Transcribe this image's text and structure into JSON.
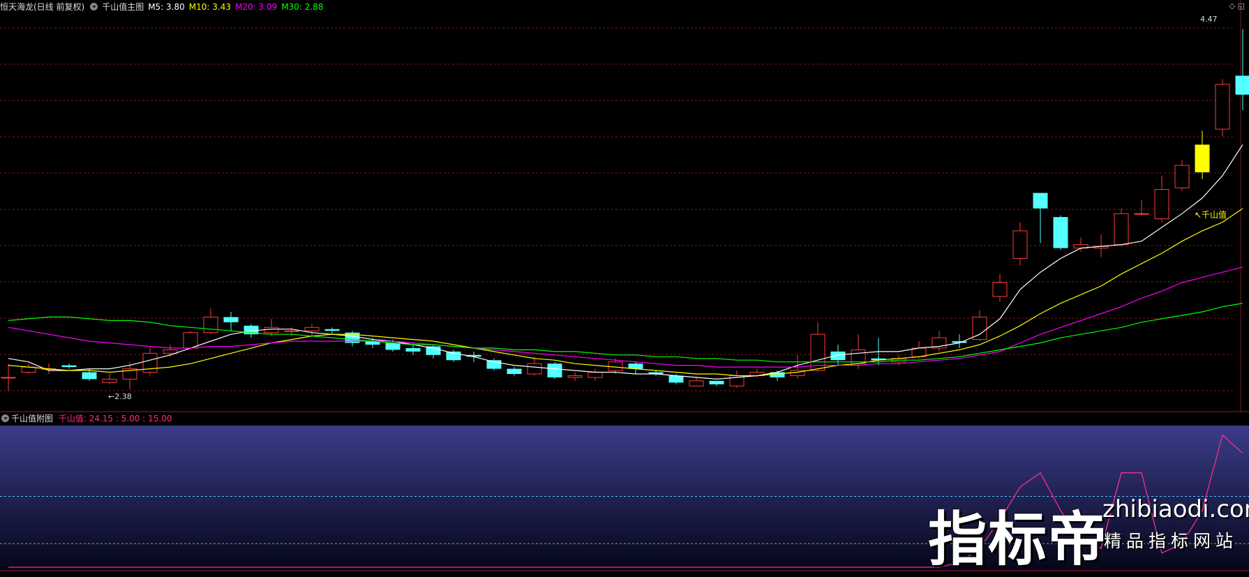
{
  "header": {
    "stock": "恒天海龙(日线 前复权)",
    "indicator": "千山值主图",
    "ma5": "M5: 3.80",
    "ma10": "M10: 3.43",
    "ma20": "M20: 3.09",
    "ma30": "M30: 2.88",
    "corner": "◇ ◱"
  },
  "sub_header": {
    "indicator": "千山值附图",
    "values": "千山值: 24.15 : 5.00 : 15.00"
  },
  "annotations": {
    "high": "4.47",
    "low": "←2.38",
    "qianshan": "↖千山值"
  },
  "watermark": {
    "big": "指标帝",
    "domain": "zhibiaodi.com",
    "slogan": "精品指标网站"
  },
  "colors": {
    "up": "#ff3c3c",
    "down": "#54ffff",
    "highlight": "#ffff00",
    "ma5": "#ffffff",
    "ma10": "#ffff00",
    "ma20": "#ff00ff",
    "ma30": "#00ff00",
    "sub_line": "#ff2a8a",
    "grid": "#801818"
  },
  "chart_data": {
    "type": "candlestick",
    "price_range": [
      2.3,
      4.55
    ],
    "candles": [
      [
        2.45,
        2.45,
        2.53,
        2.37
      ],
      [
        2.48,
        2.51,
        2.53,
        2.47
      ],
      [
        2.5,
        2.5,
        2.53,
        2.47
      ],
      [
        2.52,
        2.51,
        2.53,
        2.5
      ],
      [
        2.48,
        2.44,
        2.5,
        2.43
      ],
      [
        2.42,
        2.44,
        2.47,
        2.41
      ],
      [
        2.44,
        2.5,
        2.54,
        2.38
      ],
      [
        2.48,
        2.59,
        2.62,
        2.46
      ],
      [
        2.59,
        2.61,
        2.64,
        2.57
      ],
      [
        2.62,
        2.71,
        2.72,
        2.61
      ],
      [
        2.71,
        2.8,
        2.85,
        2.7
      ],
      [
        2.8,
        2.77,
        2.83,
        2.72
      ],
      [
        2.75,
        2.7,
        2.76,
        2.68
      ],
      [
        2.71,
        2.74,
        2.79,
        2.69
      ],
      [
        2.72,
        2.72,
        2.74,
        2.69
      ],
      [
        2.72,
        2.74,
        2.76,
        2.69
      ],
      [
        2.73,
        2.72,
        2.74,
        2.7
      ],
      [
        2.71,
        2.65,
        2.72,
        2.63
      ],
      [
        2.66,
        2.64,
        2.68,
        2.62
      ],
      [
        2.65,
        2.61,
        2.67,
        2.6
      ],
      [
        2.62,
        2.6,
        2.65,
        2.58
      ],
      [
        2.63,
        2.58,
        2.64,
        2.56
      ],
      [
        2.6,
        2.55,
        2.61,
        2.54
      ],
      [
        2.58,
        2.57,
        2.6,
        2.54
      ],
      [
        2.55,
        2.5,
        2.56,
        2.49
      ],
      [
        2.5,
        2.47,
        2.51,
        2.46
      ],
      [
        2.47,
        2.53,
        2.57,
        2.46
      ],
      [
        2.53,
        2.45,
        2.54,
        2.44
      ],
      [
        2.45,
        2.46,
        2.48,
        2.43
      ],
      [
        2.45,
        2.48,
        2.5,
        2.43
      ],
      [
        2.49,
        2.54,
        2.56,
        2.47
      ],
      [
        2.53,
        2.5,
        2.54,
        2.47
      ],
      [
        2.48,
        2.47,
        2.49,
        2.46
      ],
      [
        2.46,
        2.42,
        2.47,
        2.41
      ],
      [
        2.4,
        2.43,
        2.45,
        2.4
      ],
      [
        2.43,
        2.41,
        2.43,
        2.4
      ],
      [
        2.4,
        2.46,
        2.49,
        2.39
      ],
      [
        2.46,
        2.48,
        2.5,
        2.45
      ],
      [
        2.48,
        2.45,
        2.49,
        2.43
      ],
      [
        2.46,
        2.49,
        2.58,
        2.44
      ],
      [
        2.49,
        2.7,
        2.77,
        2.48
      ],
      [
        2.6,
        2.55,
        2.64,
        2.52
      ],
      [
        2.53,
        2.61,
        2.7,
        2.5
      ],
      [
        2.56,
        2.55,
        2.68,
        2.52
      ],
      [
        2.54,
        2.56,
        2.58,
        2.52
      ],
      [
        2.57,
        2.62,
        2.66,
        2.56
      ],
      [
        2.62,
        2.68,
        2.72,
        2.6
      ],
      [
        2.66,
        2.65,
        2.7,
        2.62
      ],
      [
        2.67,
        2.8,
        2.84,
        2.66
      ],
      [
        2.92,
        3.0,
        3.05,
        2.89
      ],
      [
        3.14,
        3.3,
        3.35,
        3.1
      ],
      [
        3.52,
        3.43,
        3.52,
        3.23
      ],
      [
        3.38,
        3.2,
        3.39,
        3.19
      ],
      [
        3.2,
        3.22,
        3.26,
        3.18
      ],
      [
        3.2,
        3.21,
        3.28,
        3.15
      ],
      [
        3.22,
        3.4,
        3.43,
        3.21
      ],
      [
        3.4,
        3.4,
        3.48,
        3.39
      ],
      [
        3.37,
        3.54,
        3.62,
        3.35
      ],
      [
        3.55,
        3.68,
        3.71,
        3.53
      ],
      [
        3.8,
        3.64,
        3.88,
        3.6
      ],
      [
        3.89,
        4.15,
        4.18,
        3.85
      ],
      [
        4.2,
        4.09,
        4.47,
        4.0
      ]
    ],
    "ma_series": [
      {
        "name": "M5",
        "color": "#ffffff",
        "y": [
          2.56,
          2.54,
          2.49,
          2.49,
          2.5,
          2.5,
          2.52,
          2.55,
          2.58,
          2.62,
          2.66,
          2.7,
          2.72,
          2.73,
          2.73,
          2.71,
          2.7,
          2.69,
          2.67,
          2.66,
          2.64,
          2.62,
          2.59,
          2.57,
          2.54,
          2.52,
          2.51,
          2.5,
          2.49,
          2.48,
          2.48,
          2.47,
          2.47,
          2.46,
          2.45,
          2.44,
          2.45,
          2.46,
          2.48,
          2.52,
          2.55,
          2.58,
          2.59,
          2.6,
          2.6,
          2.62,
          2.63,
          2.65,
          2.7,
          2.79,
          2.96,
          3.06,
          3.14,
          3.2,
          3.21,
          3.22,
          3.24,
          3.32,
          3.4,
          3.49,
          3.62,
          3.8
        ]
      },
      {
        "name": "M10",
        "color": "#ffff00",
        "y": [
          2.52,
          2.51,
          2.5,
          2.49,
          2.49,
          2.48,
          2.49,
          2.5,
          2.51,
          2.53,
          2.56,
          2.59,
          2.62,
          2.65,
          2.67,
          2.69,
          2.7,
          2.7,
          2.69,
          2.68,
          2.67,
          2.66,
          2.64,
          2.62,
          2.6,
          2.58,
          2.56,
          2.55,
          2.53,
          2.52,
          2.51,
          2.5,
          2.49,
          2.48,
          2.47,
          2.47,
          2.46,
          2.46,
          2.47,
          2.48,
          2.5,
          2.52,
          2.53,
          2.55,
          2.56,
          2.57,
          2.59,
          2.61,
          2.64,
          2.69,
          2.75,
          2.82,
          2.88,
          2.93,
          2.98,
          3.05,
          3.11,
          3.17,
          3.24,
          3.3,
          3.35,
          3.43
        ]
      },
      {
        "name": "M20",
        "color": "#ff00ff",
        "y": [
          2.74,
          2.72,
          2.7,
          2.68,
          2.66,
          2.65,
          2.64,
          2.63,
          2.62,
          2.62,
          2.63,
          2.63,
          2.64,
          2.65,
          2.66,
          2.66,
          2.66,
          2.66,
          2.66,
          2.66,
          2.65,
          2.64,
          2.63,
          2.62,
          2.61,
          2.6,
          2.59,
          2.58,
          2.57,
          2.56,
          2.55,
          2.54,
          2.53,
          2.52,
          2.52,
          2.51,
          2.51,
          2.51,
          2.51,
          2.51,
          2.52,
          2.52,
          2.52,
          2.53,
          2.53,
          2.54,
          2.55,
          2.56,
          2.58,
          2.6,
          2.65,
          2.7,
          2.74,
          2.78,
          2.82,
          2.86,
          2.91,
          2.95,
          3.0,
          3.03,
          3.06,
          3.09
        ]
      },
      {
        "name": "M30",
        "color": "#00ff00",
        "y": [
          2.78,
          2.79,
          2.8,
          2.8,
          2.79,
          2.78,
          2.78,
          2.77,
          2.75,
          2.74,
          2.73,
          2.72,
          2.71,
          2.7,
          2.7,
          2.69,
          2.68,
          2.67,
          2.66,
          2.65,
          2.64,
          2.64,
          2.63,
          2.62,
          2.62,
          2.61,
          2.61,
          2.6,
          2.6,
          2.59,
          2.58,
          2.58,
          2.57,
          2.57,
          2.56,
          2.56,
          2.55,
          2.55,
          2.54,
          2.54,
          2.54,
          2.54,
          2.54,
          2.54,
          2.55,
          2.55,
          2.56,
          2.57,
          2.59,
          2.61,
          2.63,
          2.65,
          2.68,
          2.7,
          2.72,
          2.74,
          2.77,
          2.79,
          2.81,
          2.83,
          2.86,
          2.88
        ]
      }
    ],
    "sub_range": [
      0,
      30
    ],
    "sub_reference_lines": [
      15,
      5
    ],
    "sub_series": {
      "name": "千山值",
      "color": "#ff2a8a",
      "y": [
        0,
        0,
        0,
        0,
        0,
        0,
        0,
        0,
        0,
        0,
        0,
        0,
        0,
        0,
        0,
        0,
        0,
        0,
        0,
        0,
        0,
        0,
        0,
        0,
        0,
        0,
        0,
        0,
        0,
        0,
        0,
        0,
        0,
        0,
        0,
        0,
        0,
        0,
        0,
        0,
        0,
        0,
        0,
        0,
        0,
        0,
        0,
        1,
        4,
        10,
        17,
        20,
        12,
        6,
        4,
        20,
        20,
        3,
        5,
        12,
        28,
        24.15
      ]
    }
  }
}
